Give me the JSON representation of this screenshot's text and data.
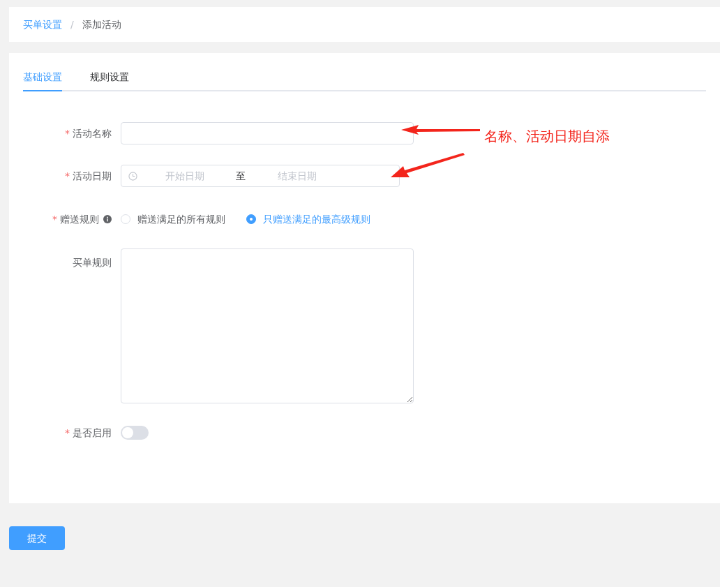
{
  "breadcrumb": [
    {
      "label": "买单设置",
      "link": true
    },
    {
      "label": "添加活动",
      "link": false
    }
  ],
  "breadcrumb_separator": "/",
  "tabs": [
    {
      "label": "基础设置",
      "selected": true
    },
    {
      "label": "规则设置",
      "selected": false
    }
  ],
  "form": [
    {
      "kind": "text",
      "label": "活动名称",
      "required_mark": "*"
    },
    {
      "kind": "daterange",
      "label": "活动日期",
      "required_mark": "*",
      "start_placeholder": "开始日期",
      "separator": "至",
      "end_placeholder": "结束日期"
    },
    {
      "kind": "radio",
      "label": "赠送规则",
      "required_mark": "*",
      "info": true,
      "options": [
        {
          "label": "赠送满足的所有规则",
          "selected": false
        },
        {
          "label": "只赠送满足的最高级规则",
          "selected": true
        }
      ]
    },
    {
      "kind": "textarea",
      "label": "买单规则"
    },
    {
      "kind": "switch",
      "label": "是否启用",
      "required_mark": "*",
      "on": false
    }
  ],
  "submit": "提交",
  "annotation": "名称、活动日期自添"
}
